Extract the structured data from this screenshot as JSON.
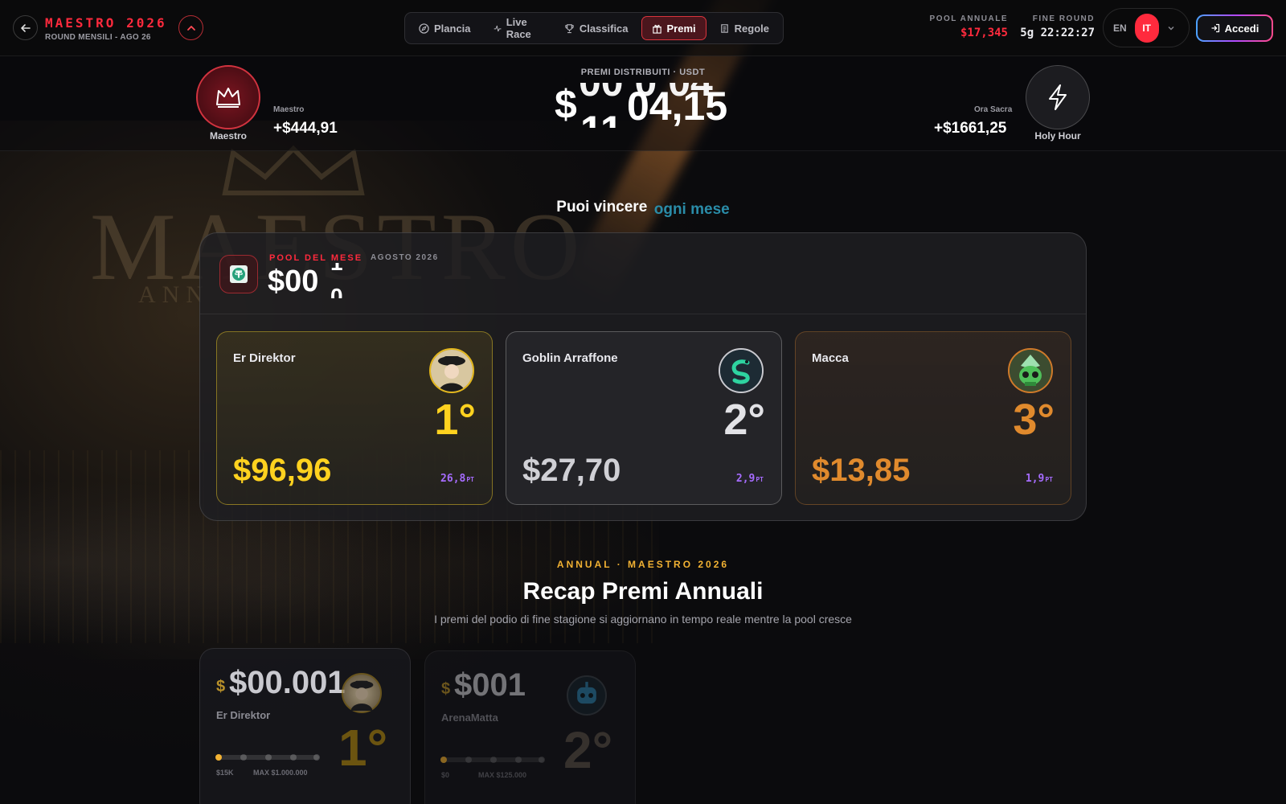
{
  "header": {
    "brand_title": "MAESTRO 2026",
    "brand_subtitle": "ROUND MENSILI - AGO 26",
    "nav": [
      {
        "label": "Plancia",
        "icon": "compass-icon",
        "active": false
      },
      {
        "label": "Live Race",
        "icon": "pulse-icon",
        "active": false
      },
      {
        "label": "Classifica",
        "icon": "trophy-icon",
        "active": false
      },
      {
        "label": "Premi",
        "icon": "gift-icon",
        "active": true
      },
      {
        "label": "Regole",
        "icon": "scroll-icon",
        "active": false
      }
    ],
    "pool_annuale_label": "POOL ANNUALE",
    "pool_annuale_value": "$17,345",
    "fine_round_label": "FINE ROUND",
    "fine_round_value": "5g 22:22:27",
    "lang_en": "EN",
    "lang_it": "IT",
    "login_label": "Accedi"
  },
  "ticker": {
    "left_badge_caption": "Maestro",
    "left_label": "Maestro",
    "left_value": "+$444,91",
    "distributed_label": "PREMI DISTRIBUITI · USDT",
    "roller_dollar": "$",
    "roller_top": "00 0 04",
    "roller_main": "04,15",
    "roller_bottom": "11",
    "right_label": "Ora Sacra",
    "right_value": "+$1661,25",
    "right_badge_caption": "Holy Hour"
  },
  "headline": {
    "text": "Puoi vincere",
    "accent": "ogni mese"
  },
  "monthly_pool": {
    "label": "POOL DEL MESE",
    "month": "AGOSTO 2026",
    "amount_main": "$00",
    "amount_top": "1",
    "amount_bottom": "0",
    "icon": "tether-icon",
    "podium": [
      {
        "name": "Er Direktor",
        "rank": "1°",
        "prize": "$96,96",
        "points": "26,8",
        "unit": "PT",
        "avatar": "director-avatar"
      },
      {
        "name": "Goblin Arraffone",
        "rank": "2°",
        "prize": "$27,70",
        "points": "2,9",
        "unit": "PT",
        "avatar": "snake-avatar"
      },
      {
        "name": "Macca",
        "rank": "3°",
        "prize": "$13,85",
        "points": "1,9",
        "unit": "PT",
        "avatar": "skull-avatar"
      }
    ]
  },
  "annual": {
    "kicker": "ANNUAL · MAESTRO 2026",
    "title": "Recap Premi Annuali",
    "subtitle": "I premi del podio di fine stagione si aggiornano in tempo reale mentre la pool cresce",
    "cards": [
      {
        "currency": "$",
        "amount": "$00.001",
        "name": "Er Direktor",
        "rank": "1°",
        "min": "$15K",
        "max": "MAX $1.000.000",
        "progress": 0.0
      },
      {
        "currency": "$",
        "amount": "$001",
        "name": "ArenaMatta",
        "rank": "2°",
        "min": "$0",
        "max": "MAX $125.000",
        "progress": 0.0
      }
    ]
  },
  "colors": {
    "accent_red": "#ff2a3d",
    "gold": "#ffd21f",
    "silver": "#e2e2e6",
    "bronze": "#e08a2d",
    "points_purple": "#a66cff",
    "teal": "#2a8ca8"
  }
}
